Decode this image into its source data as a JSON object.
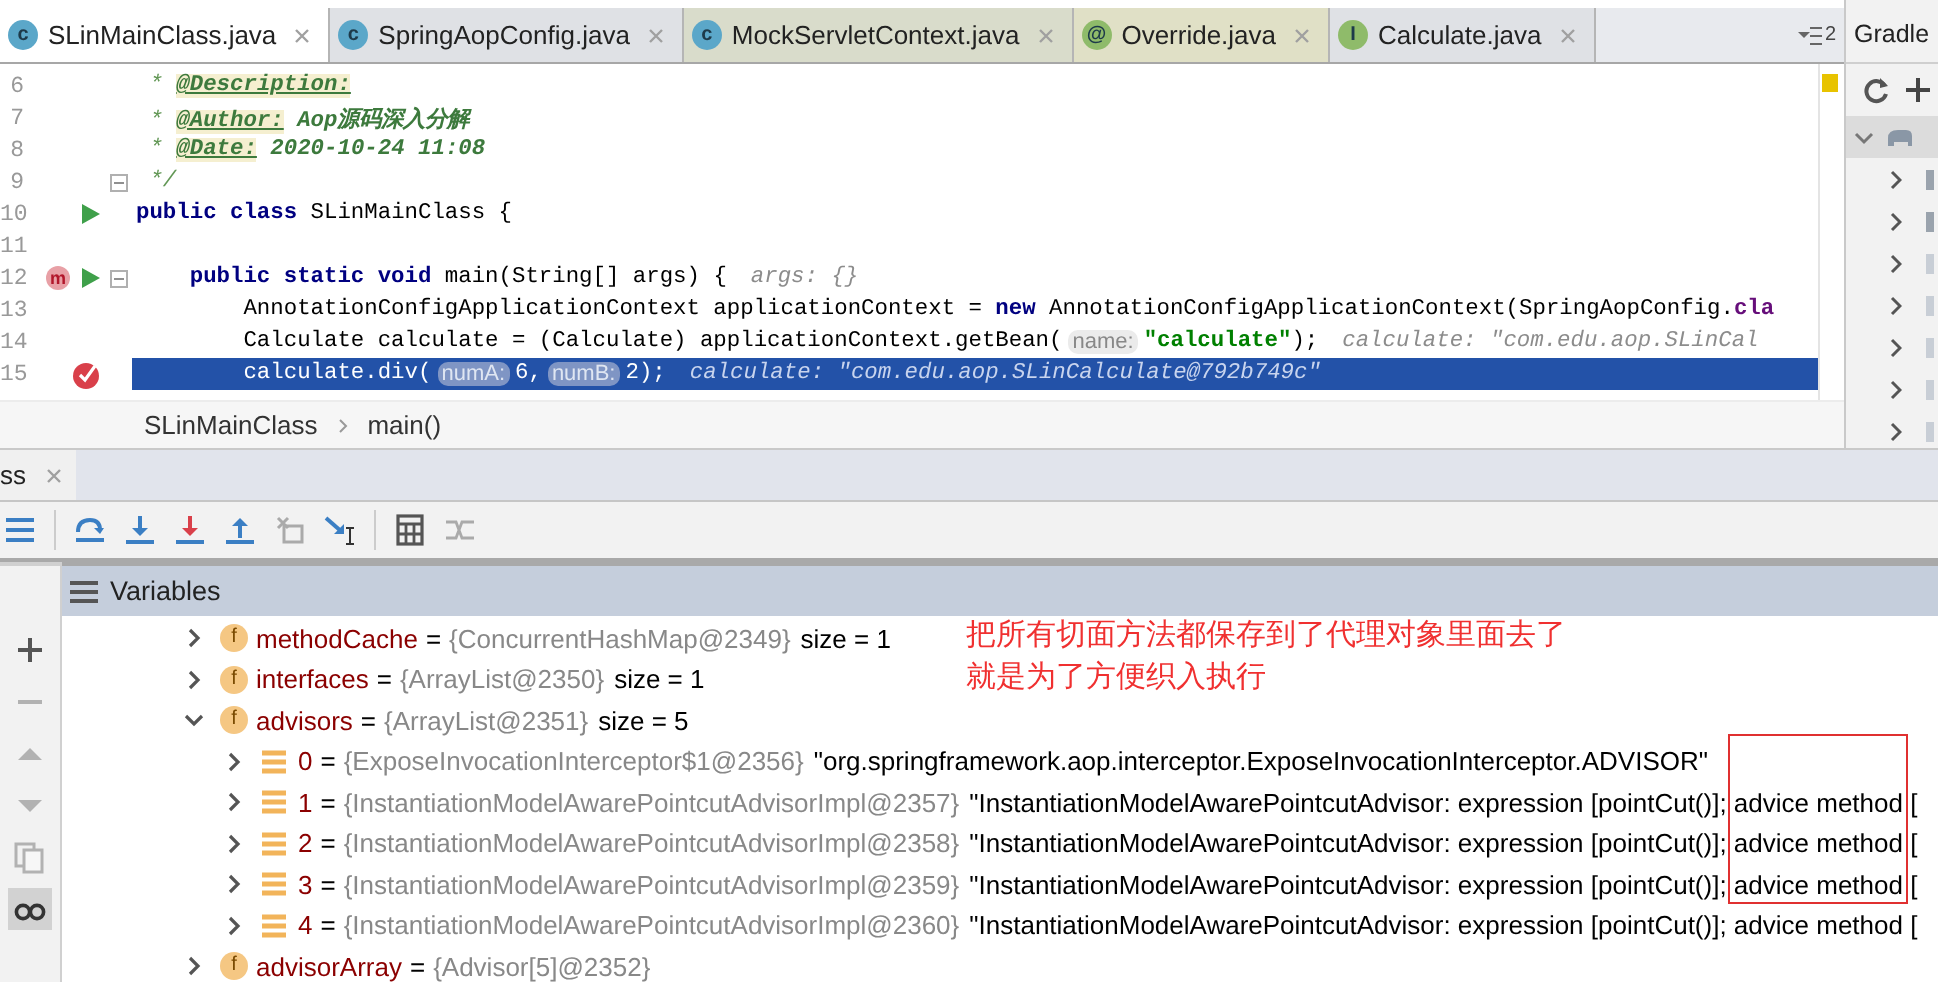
{
  "editor_tabs": [
    {
      "label": "SLinMainClass.java",
      "icon_text": "c",
      "kind": "class",
      "selected": true
    },
    {
      "label": "SpringAopConfig.java",
      "icon_text": "c",
      "kind": "class",
      "selected": false
    },
    {
      "label": "MockServletContext.java",
      "icon_text": "c",
      "kind": "class",
      "selected": false
    },
    {
      "label": "Override.java",
      "icon_text": "@",
      "kind": "annotation",
      "selected": false
    },
    {
      "label": "Calculate.java",
      "icon_text": "I",
      "kind": "interface",
      "selected": false
    }
  ],
  "tab_overflow": "2",
  "code_lines": [
    {
      "number": "6",
      "fold": false,
      "current": false,
      "segments": [
        {
          "kind": "star",
          "text": " * "
        },
        {
          "kind": "doc-tag",
          "text": "@Description:"
        }
      ]
    },
    {
      "number": "7",
      "fold": false,
      "current": false,
      "segments": [
        {
          "kind": "star",
          "text": " * "
        },
        {
          "kind": "doc-tag",
          "text": "@Author:"
        },
        {
          "kind": "doc",
          "text": " Aop源码深入分解"
        }
      ]
    },
    {
      "number": "8",
      "fold": false,
      "current": false,
      "segments": [
        {
          "kind": "star",
          "text": " * "
        },
        {
          "kind": "doc-tag",
          "text": "@Date:"
        },
        {
          "kind": "doc",
          "text": " 2020-10-24 11:08"
        }
      ]
    },
    {
      "number": "9",
      "fold": true,
      "current": false,
      "segments": [
        {
          "kind": "star",
          "text": " */"
        }
      ]
    },
    {
      "number": "10",
      "gutter": {
        "kind": "run"
      },
      "fold": false,
      "current": false,
      "segments": [
        {
          "kind": "keyword",
          "text": "public class"
        },
        {
          "kind": "plain",
          "text": " SLinMainClass {"
        }
      ]
    },
    {
      "number": "11",
      "fold": false,
      "current": false
    },
    {
      "number": "12",
      "gutter": {
        "kind": "method-run",
        "badge": "m"
      },
      "fold": true,
      "current": false,
      "segments": [
        {
          "kind": "keyword",
          "text": "    public static void"
        },
        {
          "kind": "plain",
          "text": " main(String[] args) {"
        },
        {
          "kind": "hint",
          "text": "args: {}"
        }
      ]
    },
    {
      "number": "13",
      "fold": false,
      "current": false,
      "segments": [
        {
          "kind": "plain",
          "text": "        AnnotationConfigApplicationContext applicationContext = "
        },
        {
          "kind": "keyword",
          "text": "new"
        },
        {
          "kind": "plain",
          "text": " AnnotationConfigApplicationContext(SpringAopConfig."
        },
        {
          "kind": "field",
          "text": "cla"
        }
      ]
    },
    {
      "number": "14",
      "fold": false,
      "current": false,
      "segments": [
        {
          "kind": "plain",
          "text": "        Calculate calculate = (Calculate) applicationContext.getBean("
        },
        {
          "kind": "param",
          "text": "name:"
        },
        {
          "kind": "string",
          "text": "\"calculate\""
        },
        {
          "kind": "plain",
          "text": ");"
        },
        {
          "kind": "hint",
          "text": "calculate: \"com.edu.aop.SLinCal"
        }
      ]
    },
    {
      "number": "15",
      "gutter": {
        "kind": "breakpoint"
      },
      "fold": false,
      "current": true,
      "segments": [
        {
          "kind": "plain",
          "text": "        calculate.div("
        },
        {
          "kind": "param",
          "text": "numA:"
        },
        {
          "kind": "plain",
          "text": "6,"
        },
        {
          "kind": "param",
          "text": "numB:"
        },
        {
          "kind": "plain",
          "text": "2);"
        },
        {
          "kind": "hint",
          "text": "calculate: \"com.edu.aop.SLinCalculate@792b749c\""
        }
      ]
    }
  ],
  "breadcrumb": [
    "SLinMainClass",
    "main()"
  ],
  "gradle": {
    "title": "Gradle"
  },
  "debug_tab": {
    "label": "ss"
  },
  "side_buttons": [
    {
      "kind": "add",
      "disabled": false,
      "on": false
    },
    {
      "kind": "remove",
      "disabled": true,
      "on": false
    },
    {
      "kind": "up",
      "disabled": true,
      "on": false
    },
    {
      "kind": "down",
      "disabled": true,
      "on": false
    },
    {
      "kind": "copy",
      "disabled": true,
      "on": false
    },
    {
      "kind": "watches",
      "disabled": false,
      "on": true
    }
  ],
  "variables": {
    "title": "Variables",
    "rows": [
      {
        "kind": "field",
        "icon_text": "f",
        "name": "methodCache",
        "op": "=",
        "value": "{ConcurrentHashMap@2349}",
        "extra": "size = 1",
        "expanded": false
      },
      {
        "kind": "field",
        "icon_text": "f",
        "name": "interfaces",
        "op": "=",
        "value": "{ArrayList@2350}",
        "extra": "size = 1",
        "expanded": false
      },
      {
        "kind": "field",
        "icon_text": "f",
        "name": "advisors",
        "op": "=",
        "value": "{ArrayList@2351}",
        "extra": "size = 5",
        "expanded": true,
        "children": [
          {
            "kind": "element",
            "name": "0",
            "op": "=",
            "value": "{ExposeInvocationInterceptor$1@2356}",
            "extra": "\"org.springframework.aop.interceptor.ExposeInvocationInterceptor.ADVISOR\"",
            "expanded": false
          },
          {
            "kind": "element",
            "name": "1",
            "op": "=",
            "value": "{InstantiationModelAwarePointcutAdvisorImpl@2357}",
            "extra": "\"InstantiationModelAwarePointcutAdvisor: expression [pointCut()]; advice method [",
            "expanded": false
          },
          {
            "kind": "element",
            "name": "2",
            "op": "=",
            "value": "{InstantiationModelAwarePointcutAdvisorImpl@2358}",
            "extra": "\"InstantiationModelAwarePointcutAdvisor: expression [pointCut()]; advice method [",
            "expanded": false
          },
          {
            "kind": "element",
            "name": "3",
            "op": "=",
            "value": "{InstantiationModelAwarePointcutAdvisorImpl@2359}",
            "extra": "\"InstantiationModelAwarePointcutAdvisor: expression [pointCut()]; advice method [",
            "expanded": false
          },
          {
            "kind": "element",
            "name": "4",
            "op": "=",
            "value": "{InstantiationModelAwarePointcutAdvisorImpl@2360}",
            "extra": "\"InstantiationModelAwarePointcutAdvisor: expression [pointCut()]; advice method [",
            "expanded": false
          }
        ]
      },
      {
        "kind": "field",
        "icon_text": "f",
        "name": "advisorArray",
        "op": "=",
        "value": "{Advisor[5]@2352}",
        "expanded": false
      }
    ]
  },
  "annotation": {
    "lines": [
      "把所有切面方法都保存到了代理对象里面去了",
      "就是为了方便织入执行"
    ]
  }
}
